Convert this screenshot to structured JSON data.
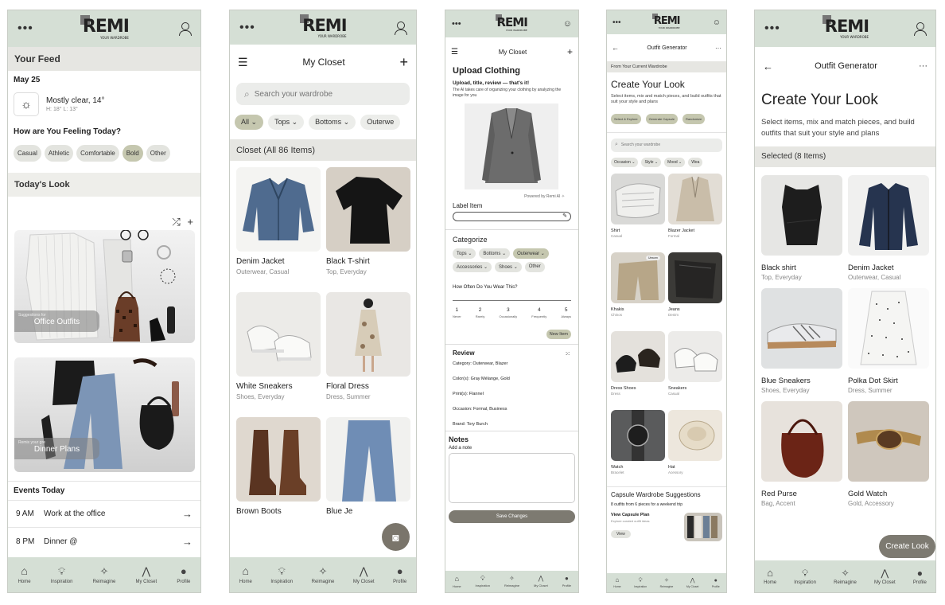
{
  "brand": {
    "name": "REMI",
    "tagline": "YOUR WARDROBE"
  },
  "s1": {
    "feed_title": "Your Feed",
    "date": "May 25",
    "weather": {
      "summary": "Mostly clear, 14°",
      "detail": "H: 18° L: 13°"
    },
    "feeling_q": "How are You Feeling Today?",
    "moods": [
      "Casual",
      "Athletic",
      "Comfortable",
      "Bold",
      "Other"
    ],
    "todays_look": "Today's Look",
    "card1": {
      "small": "Suggestions for",
      "title": "Office Outfits"
    },
    "card2": {
      "small": "Remix your gre",
      "title": "Dinner Plans"
    },
    "events_title": "Events Today",
    "events": [
      {
        "time": "9 AM",
        "title": "Work at the office"
      },
      {
        "time": "8 PM",
        "title": "Dinner @"
      }
    ]
  },
  "s2": {
    "title": "My Closet",
    "search_placeholder": "Search your wardrobe",
    "filters": [
      "All",
      "Tops",
      "Bottoms",
      "Outerwe"
    ],
    "count_title": "Closet (All 86 Items)",
    "items": [
      {
        "name": "Denim Jacket",
        "sub": "Outerwear, Casual"
      },
      {
        "name": "Black T-shirt",
        "sub": "Top, Everyday"
      },
      {
        "name": "White Sneakers",
        "sub": "Shoes, Everyday"
      },
      {
        "name": "Floral Dress",
        "sub": "Dress, Summer"
      },
      {
        "name": "Brown Boots",
        "sub": ""
      },
      {
        "name": "Blue Je",
        "sub": ""
      }
    ]
  },
  "s3": {
    "title": "My Closet",
    "upload_title": "Upload Clothing",
    "upload_subtitle": "Upload, title, review — that's it!",
    "upload_desc": "The AI takes care of organizing your clothing by analyzing the image for you",
    "powered": "Powered by Remi AI",
    "label_item": "Label Item",
    "categorize": "Categorize",
    "cats": [
      "Tops",
      "Bottoms",
      "Outerwear",
      "Accessories",
      "Shoes",
      "Other"
    ],
    "freq_q": "How Often Do You Wear This?",
    "scale": [
      {
        "n": "1",
        "l": "Never"
      },
      {
        "n": "2",
        "l": "Rarely"
      },
      {
        "n": "3",
        "l": "Occasionally"
      },
      {
        "n": "4",
        "l": "Frequently"
      },
      {
        "n": "5",
        "l": "Always"
      }
    ],
    "new_item": "New Item",
    "review_title": "Review",
    "review": [
      "Category: Outerwear, Blazer",
      "Color(s): Gray Mélange, Gold",
      "Print(s): Flannel",
      "Occasion: Formal, Business",
      "Brand: Tory Burch"
    ],
    "notes_title": "Notes",
    "notes_label": "Add a note",
    "save": "Save Changes"
  },
  "s4": {
    "title": "Outfit Generator",
    "from": "From Your Current Wardrobe",
    "heading": "Create Your Look",
    "desc": "Select items, mix and match pieces, and build outfits that suit your style and plans",
    "actions": [
      "Select & Explore",
      "Generate Capsule",
      "Randomize"
    ],
    "search_placeholder": "Search your wardrobe",
    "filters": [
      "Occasion",
      "Style",
      "Mood",
      "Wea"
    ],
    "items": [
      {
        "name": "Shirt",
        "sub": "Casual"
      },
      {
        "name": "Blazer Jacket",
        "sub": "Formal"
      },
      {
        "name": "Khakis",
        "sub": "Chinos",
        "tag": "Unworn"
      },
      {
        "name": "Jeans",
        "sub": "Denim"
      },
      {
        "name": "Dress Shoes",
        "sub": "Dress"
      },
      {
        "name": "Sneakers",
        "sub": "Casual"
      },
      {
        "name": "Watch",
        "sub": "Bracelet"
      },
      {
        "name": "Hat",
        "sub": "Acessory"
      }
    ],
    "capsule_title": "Capsule Wardrobe Suggestions",
    "capsule_desc": "8 outfits from 6 pieces for a weekend trip",
    "plan_title": "View Capsule Plan",
    "plan_desc": "Explore curated outfit ideas",
    "view": "View"
  },
  "s5": {
    "title": "Outfit Generator",
    "heading": "Create Your Look",
    "desc": "Select items, mix and match pieces, and build outfits that suit your style and plans",
    "selected": "Selected (8 Items)",
    "items": [
      {
        "name": "Black shirt",
        "sub": "Top, Everyday"
      },
      {
        "name": "Denim Jacket",
        "sub": "Outerwear, Casual"
      },
      {
        "name": "Blue Sneakers",
        "sub": "Shoes, Everyday"
      },
      {
        "name": "Polka Dot Skirt",
        "sub": "Dress, Summer"
      },
      {
        "name": "Red Purse",
        "sub": "Bag, Accent"
      },
      {
        "name": "Gold Watch",
        "sub": "Gold, Accessory"
      }
    ],
    "create_btn": "Create Look"
  },
  "nav": [
    "Home",
    "Inspiration",
    "Reimagine",
    "My Closet",
    "Profile"
  ],
  "icons": {
    "home": "home-icon",
    "inspiration": "lightbulb-icon",
    "reimagine": "magic-wand-icon",
    "closet": "hanger-icon",
    "profile": "profile-icon"
  },
  "colors": {
    "header": "#d5dfd5",
    "chip_active": "#c5c7af",
    "section": "#e6e6e2",
    "button_dark": "#7d7a71"
  }
}
